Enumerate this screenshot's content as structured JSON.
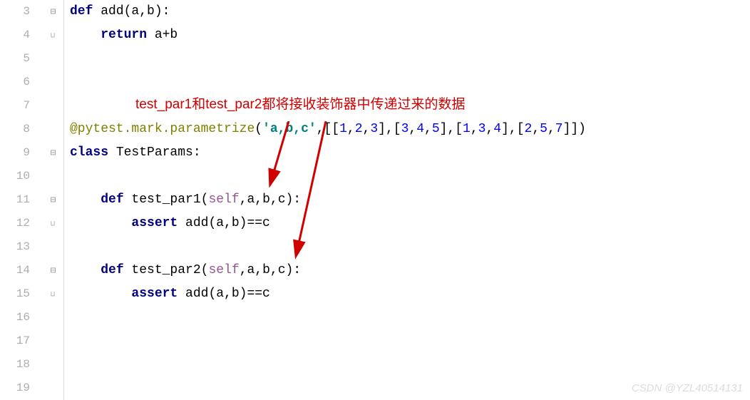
{
  "gutter": {
    "start": 3,
    "end": 19
  },
  "annotation": {
    "text": "test_par1和test_par2都将接收装饰器中传递过来的数据"
  },
  "code": {
    "l3": {
      "def": "def",
      "name": "add",
      "args": "(a,b):"
    },
    "l4": {
      "ret": "return",
      "expr": " a+b"
    },
    "l8": {
      "decorator": "@pytest.mark.parametrize",
      "open": "(",
      "str": "'a,b,c'",
      "comma": ",[[",
      "n1": "1",
      "c1": ",",
      "n2": "2",
      "c2": ",",
      "n3": "3",
      "mid1": "],[",
      "n4": "3",
      "c3": ",",
      "n5": "4",
      "c4": ",",
      "n6": "5",
      "mid2": "],[",
      "n7": "1",
      "c5": ",",
      "n8": "3",
      "c6": ",",
      "n9": "4",
      "mid3": "],[",
      "n10": "2",
      "c7": ",",
      "n11": "5",
      "c8": ",",
      "n12": "7",
      "close": "]])"
    },
    "l9": {
      "kw": "class",
      "name": " TestParams:"
    },
    "l11": {
      "def": "def",
      "name": " test_par1",
      "open": "(",
      "self": "self",
      "rest": ",a,b,c):"
    },
    "l12": {
      "assert": "assert",
      "expr": " add(a,b)==c"
    },
    "l14": {
      "def": "def",
      "name": " test_par2",
      "open": "(",
      "self": "self",
      "rest": ",a,b,c):"
    },
    "l15": {
      "assert": "assert",
      "expr": " add(a,b)==c"
    }
  },
  "watermark": "CSDN @YZL40514131"
}
